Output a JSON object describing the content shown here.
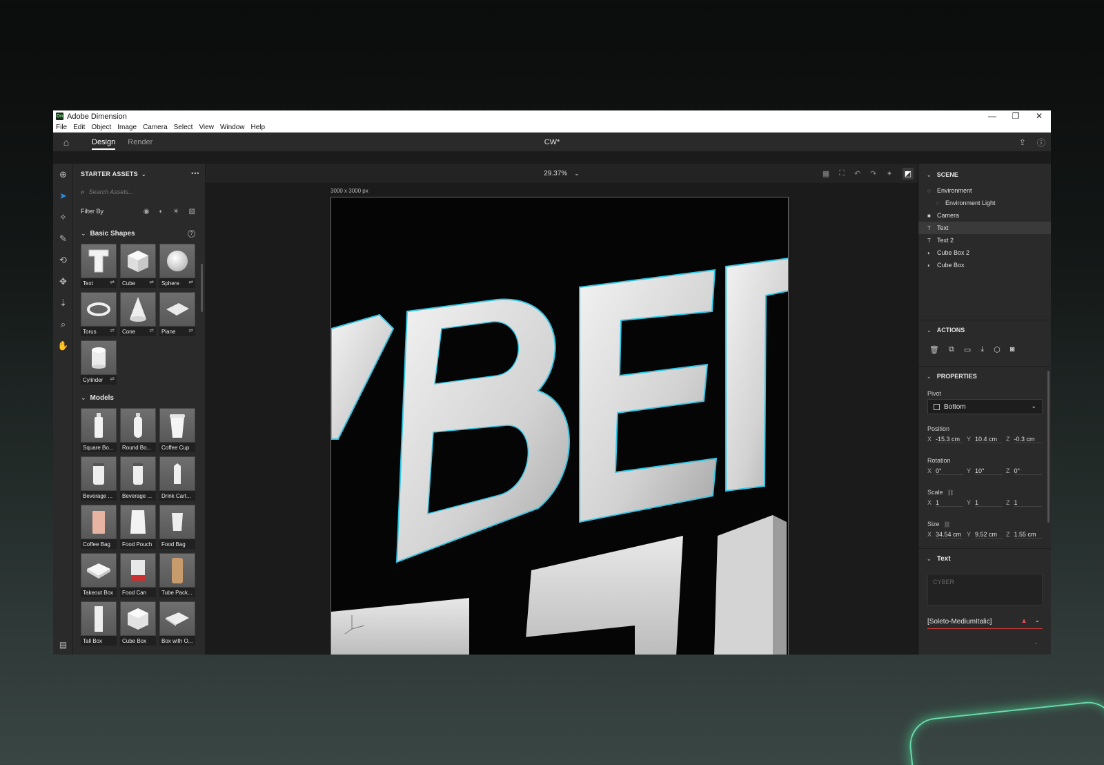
{
  "window": {
    "app_title": "Adobe Dimension",
    "logo_text": "Dn",
    "controls": {
      "minimize": "—",
      "restore": "❐",
      "close": "✕"
    }
  },
  "menu": [
    "File",
    "Edit",
    "Object",
    "Image",
    "Camera",
    "Select",
    "View",
    "Window",
    "Help"
  ],
  "topbar": {
    "home_icon": "home-icon",
    "tabs": [
      {
        "label": "Design",
        "active": true
      },
      {
        "label": "Render",
        "active": false
      }
    ],
    "doc_title": "CW*"
  },
  "assets": {
    "header": "STARTER ASSETS",
    "search_placeholder": "Search Assets...",
    "filter_label": "Filter By",
    "basic_shapes_title": "Basic Shapes",
    "basic_shapes": [
      {
        "label": "Text",
        "icon": "text-3d"
      },
      {
        "label": "Cube",
        "icon": "cube"
      },
      {
        "label": "Sphere",
        "icon": "sphere"
      },
      {
        "label": "Torus",
        "icon": "torus"
      },
      {
        "label": "Cone",
        "icon": "cone"
      },
      {
        "label": "Plane",
        "icon": "plane"
      },
      {
        "label": "Cylinder",
        "icon": "cylinder"
      }
    ],
    "models_title": "Models",
    "models": [
      {
        "label": "Square Bo..."
      },
      {
        "label": "Round Bo..."
      },
      {
        "label": "Coffee Cup"
      },
      {
        "label": "Beverage ..."
      },
      {
        "label": "Beverage ..."
      },
      {
        "label": "Drink Cart..."
      },
      {
        "label": "Coffee Bag"
      },
      {
        "label": "Food Pouch"
      },
      {
        "label": "Food Bag"
      },
      {
        "label": "Takeout Box"
      },
      {
        "label": "Food Can"
      },
      {
        "label": "Tube Pack..."
      },
      {
        "label": "Tall Box"
      },
      {
        "label": "Cube Box"
      },
      {
        "label": "Box with O..."
      }
    ]
  },
  "canvas": {
    "zoom": "29.37%",
    "size_label": "3000 x 3000 px",
    "content_text": "CYBER"
  },
  "scene": {
    "title": "SCENE",
    "items": [
      {
        "label": "Environment",
        "indent": false,
        "selected": false
      },
      {
        "label": "Environment Light",
        "indent": true,
        "selected": false
      },
      {
        "label": "Camera",
        "indent": false,
        "selected": false
      },
      {
        "label": "Text",
        "indent": false,
        "selected": true
      },
      {
        "label": "Text 2",
        "indent": false,
        "selected": false
      },
      {
        "label": "Cube Box 2",
        "indent": false,
        "selected": false
      },
      {
        "label": "Cube Box",
        "indent": false,
        "selected": false
      }
    ]
  },
  "actions": {
    "title": "ACTIONS"
  },
  "properties": {
    "title": "PROPERTIES",
    "pivot_label": "Pivot",
    "pivot_value": "Bottom",
    "position_label": "Position",
    "position": {
      "x": "-15.3 cm",
      "y": "10.4 cm",
      "z": "-0.3 cm"
    },
    "rotation_label": "Rotation",
    "rotation": {
      "x": "0°",
      "y": "10°",
      "z": "0°"
    },
    "scale_label": "Scale",
    "scale": {
      "x": "1",
      "y": "1",
      "z": "1"
    },
    "size_label": "Size",
    "size": {
      "x": "34.54 cm",
      "y": "9.52 cm",
      "z": "1.55 cm"
    }
  },
  "text_section": {
    "title": "Text",
    "text_value": "CYBER",
    "font": "[Soleto-MediumItalic]"
  },
  "colors": {
    "accent_blue": "#2d8fe6",
    "selection_outline": "#33c7e6",
    "warning_red": "#e34850"
  }
}
